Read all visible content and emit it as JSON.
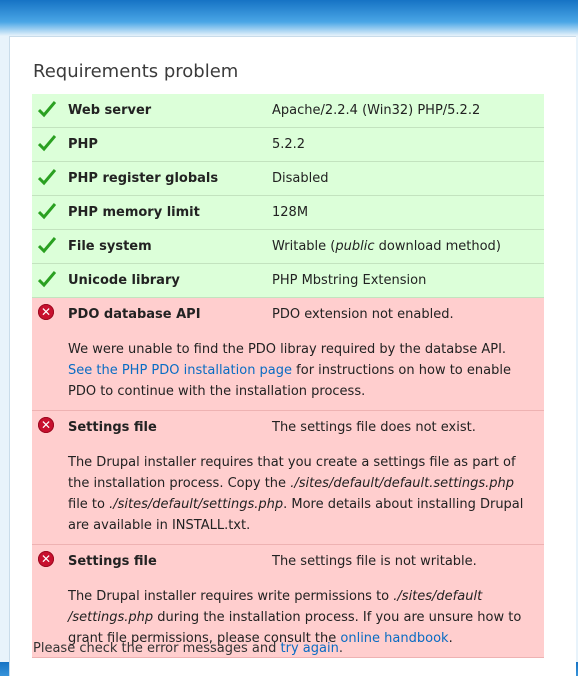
{
  "page": {
    "title": "Requirements problem"
  },
  "requirements": [
    {
      "status": "ok",
      "name": "Web server",
      "value": "Apache/2.2.4 (Win32) PHP/5.2.2"
    },
    {
      "status": "ok",
      "name": "PHP",
      "value": "5.2.2"
    },
    {
      "status": "ok",
      "name": "PHP register globals",
      "value": "Disabled"
    },
    {
      "status": "ok",
      "name": "PHP memory limit",
      "value": "128M"
    },
    {
      "status": "ok",
      "name": "File system",
      "value_pre": "Writable (",
      "value_em": "public",
      "value_post": " download method)"
    },
    {
      "status": "ok",
      "name": "Unicode library",
      "value": "PHP Mbstring Extension"
    },
    {
      "status": "error",
      "name": "PDO database API",
      "value": "PDO extension not enabled.",
      "desc_1": "We were unable to find the PDO libray required by the databse API. ",
      "desc_link": "See the PHP PDO installation page",
      "desc_2": " for instructions on how to enable PDO to continue with the installation process."
    },
    {
      "status": "error",
      "name": "Settings file",
      "value": "The settings file does not exist.",
      "desc_1": "The Drupal installer requires that you create a settings file as part of the installation process. Copy the ",
      "desc_em1": "./sites/default/default.settings.php",
      "desc_2": " file to ",
      "desc_em2": "./sites/default/settings.php",
      "desc_3": ". More details about installing Drupal are available in INSTALL.txt."
    },
    {
      "status": "error",
      "name": "Settings file",
      "value": "The settings file is not writable.",
      "desc_1": "The Drupal installer requires write permissions to ",
      "desc_em1": "./sites/default /settings.php",
      "desc_2": " during the installation process. If you are unsure how to grant file permissions, please consult the ",
      "desc_link": "online handbook",
      "desc_3": "."
    }
  ],
  "footer": {
    "text": "Please check the error messages and ",
    "link": "try again",
    "end": "."
  },
  "colors": {
    "ok_bg": "#dcffd9",
    "error_bg": "#ffcece",
    "link": "#0a6cc3",
    "check": "#2aa021",
    "error_icon": "#c8102e"
  },
  "icons": {
    "ok": "check-icon",
    "error": "error-icon"
  }
}
